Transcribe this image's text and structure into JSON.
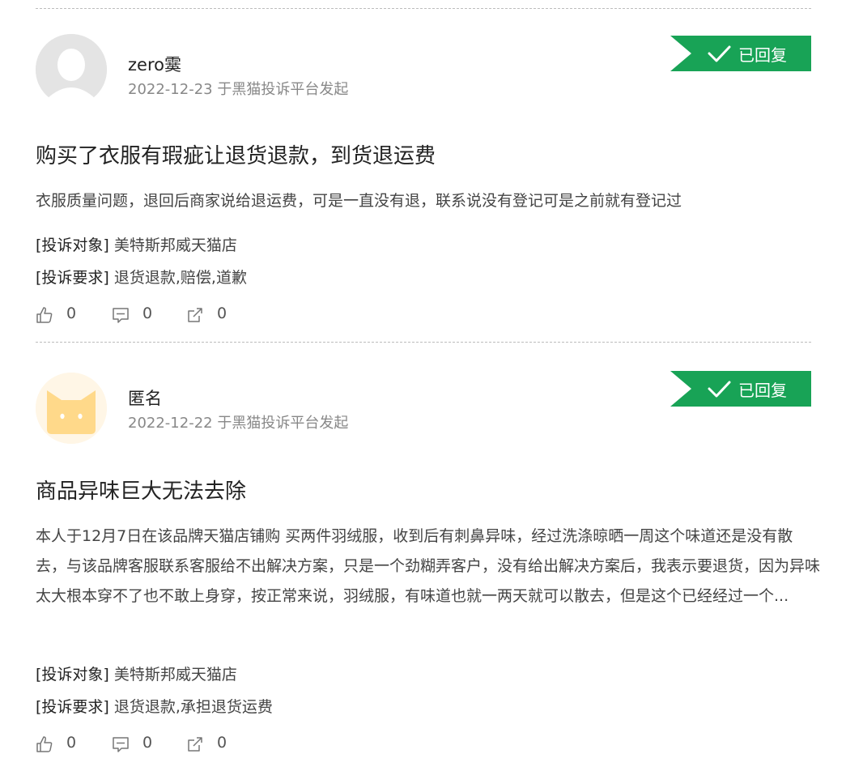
{
  "posts": [
    {
      "username": "zero霙",
      "date": "2022-12-23",
      "source": "于黑猫投诉平台发起",
      "status": "已回复",
      "title": "购买了衣服有瑕疵让退货退款，到货退运费",
      "content": "衣服质量问题，退回后商家说给退运费，可是一直没有退，联系说没有登记可是之前就有登记过",
      "target_label": "[投诉对象]",
      "target": "美特斯邦威天猫店",
      "demand_label": "[投诉要求]",
      "demand": "退货退款,赔偿,道歉",
      "likes": "0",
      "comments": "0",
      "shares": "0"
    },
    {
      "username": "匿名",
      "date": "2022-12-22",
      "source": "于黑猫投诉平台发起",
      "status": "已回复",
      "title": "商品异味巨大无法去除",
      "content": "本人于12月7日在该品牌天猫店铺购 买两件羽绒服，收到后有刺鼻异味，经过洗涤晾晒一周这个味道还是没有散去，与该品牌客服联系客服给不出解决方案，只是一个劲糊弄客户，没有给出解决方案后，我表示要退货，因为异味太大根本穿不了也不敢上身穿，按正常来说，羽绒服，有味道也就一两天就可以散去，但是这个已经经过一个...",
      "target_label": "[投诉对象]",
      "target": "美特斯邦威天猫店",
      "demand_label": "[投诉要求]",
      "demand": "退货退款,承担退货运费",
      "likes": "0",
      "comments": "0",
      "shares": "0"
    }
  ],
  "colors": {
    "badge_green": "#18a356",
    "divider": "#bdbdbd",
    "avatar_cat": "#ffd98a"
  }
}
